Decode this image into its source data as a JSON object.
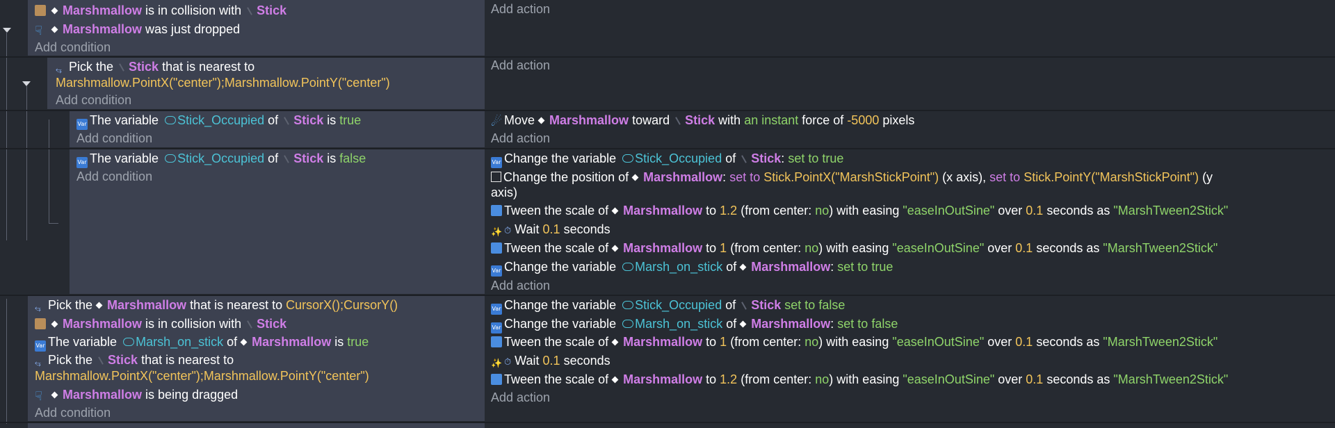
{
  "labels": {
    "add_condition": "Add condition",
    "add_action": "Add action"
  },
  "events": {
    "e1": {
      "c1": {
        "obj": "Marshmallow",
        "t1": "is in collision with",
        "obj2": "Stick"
      },
      "c2": {
        "obj": "Marshmallow",
        "t1": "was just dropped"
      }
    },
    "e2": {
      "c1": {
        "t1": "Pick the",
        "obj": "Stick",
        "t2": "that is nearest to",
        "expr": "Marshmallow.PointX(\"center\");Marshmallow.PointY(\"center\")"
      }
    },
    "e3": {
      "c1": {
        "t1": "The variable",
        "var": "Stick_Occupied",
        "t2": "of",
        "obj": "Stick",
        "t3": "is",
        "val": "true"
      },
      "a1": {
        "t1": "Move",
        "obj": "Marshmallow",
        "t2": "toward",
        "obj2": "Stick",
        "t3": "with",
        "kw": "an instant",
        "t4": "force of",
        "num": "-5000",
        "t5": "pixels"
      }
    },
    "e4": {
      "c1": {
        "t1": "The variable",
        "var": "Stick_Occupied",
        "t2": "of",
        "obj": "Stick",
        "t3": "is",
        "val": "false"
      },
      "a1": {
        "t1": "Change the variable",
        "var": "Stick_Occupied",
        "t2": "of",
        "obj": "Stick",
        "t3": ":",
        "kw": "set to true"
      },
      "a2": {
        "t1": "Change the position of",
        "obj": "Marshmallow",
        "t2": ":",
        "kw1": "set to",
        "expr1": "Stick.PointX(\"MarshStickPoint\")",
        "t3": "(x axis),",
        "kw2": "set to",
        "expr2": "Stick.PointY(\"MarshStickPoint\")",
        "t4": "(y",
        "t5": "axis)"
      },
      "a3": {
        "t1": "Tween the scale of",
        "obj": "Marshmallow",
        "t2": "to",
        "num1": "1.2",
        "t3": "(from center:",
        "kw": "no",
        "t4": ") with easing",
        "str1": "\"easeInOutSine\"",
        "t5": "over",
        "num2": "0.1",
        "t6": "seconds as",
        "str2": "\"MarshTween2Stick\""
      },
      "a4": {
        "t1": "Wait",
        "num": "0.1",
        "t2": "seconds"
      },
      "a5": {
        "t1": "Tween the scale of",
        "obj": "Marshmallow",
        "t2": "to",
        "num1": "1",
        "t3": "(from center:",
        "kw": "no",
        "t4": ") with easing",
        "str1": "\"easeInOutSine\"",
        "t5": "over",
        "num2": "0.1",
        "t6": "seconds as",
        "str2": "\"MarshTween2Stick\""
      },
      "a6": {
        "t1": "Change the variable",
        "var": "Marsh_on_stick",
        "t2": "of",
        "obj": "Marshmallow",
        "t3": ":",
        "kw": "set to true"
      }
    },
    "e5": {
      "c1": {
        "t1": "Pick the",
        "obj": "Marshmallow",
        "t2": "that is nearest to",
        "expr": "CursorX();CursorY()"
      },
      "c2": {
        "obj": "Marshmallow",
        "t1": "is in collision with",
        "obj2": "Stick"
      },
      "c3": {
        "t1": "The variable",
        "var": "Marsh_on_stick",
        "t2": "of",
        "obj": "Marshmallow",
        "t3": "is",
        "val": "true"
      },
      "c4": {
        "t1": "Pick the",
        "obj": "Stick",
        "t2": "that is nearest to",
        "expr": "Marshmallow.PointX(\"center\");Marshmallow.PointY(\"center\")"
      },
      "c5": {
        "obj": "Marshmallow",
        "t1": "is being dragged"
      },
      "a1": {
        "t1": "Change the variable",
        "var": "Stick_Occupied",
        "t2": "of",
        "obj": "Stick",
        "t3": ":",
        "kw": "set to false"
      },
      "a2": {
        "t1": "Change the variable",
        "var": "Marsh_on_stick",
        "t2": "of",
        "obj": "Marshmallow",
        "t3": ":",
        "kw": "set to false"
      },
      "a3": {
        "t1": "Tween the scale of",
        "obj": "Marshmallow",
        "t2": "to",
        "num1": "1",
        "t3": "(from center:",
        "kw": "no",
        "t4": ") with easing",
        "str1": "\"easeInOutSine\"",
        "t5": "over",
        "num2": "0.1",
        "t6": "seconds as",
        "str2": "\"MarshTween2Stick\""
      },
      "a4": {
        "t1": "Wait",
        "num": "0.1",
        "t2": "seconds"
      },
      "a5": {
        "t1": "Tween the scale of",
        "obj": "Marshmallow",
        "t2": "to",
        "num1": "1.2",
        "t3": "(from center:",
        "kw": "no",
        "t4": ") with easing",
        "str1": "\"easeInOutSine\"",
        "t5": "over",
        "num2": "0.1",
        "t6": "seconds as",
        "str2": "\"MarshTween2Stick\""
      }
    }
  },
  "icons": {
    "object": "diamond-icon",
    "stick_object": "stick-icon",
    "variable": "variable-icon",
    "pick": "pick-nearest-icon",
    "collision": "collision-icon",
    "drag": "drag-icon",
    "tween": "tween-icon",
    "wait": "stopwatch-icon",
    "move": "force-icon",
    "position": "position-icon",
    "collapse": "chevron-down-icon"
  },
  "colors": {
    "object": "#cf7ee6",
    "variable": "#4cc3d6",
    "keyword": "#8fd46a",
    "number": "#f2c45a",
    "muted": "#9da3ad",
    "condition_bg": "#3c4150",
    "action_bg": "#262a31"
  }
}
